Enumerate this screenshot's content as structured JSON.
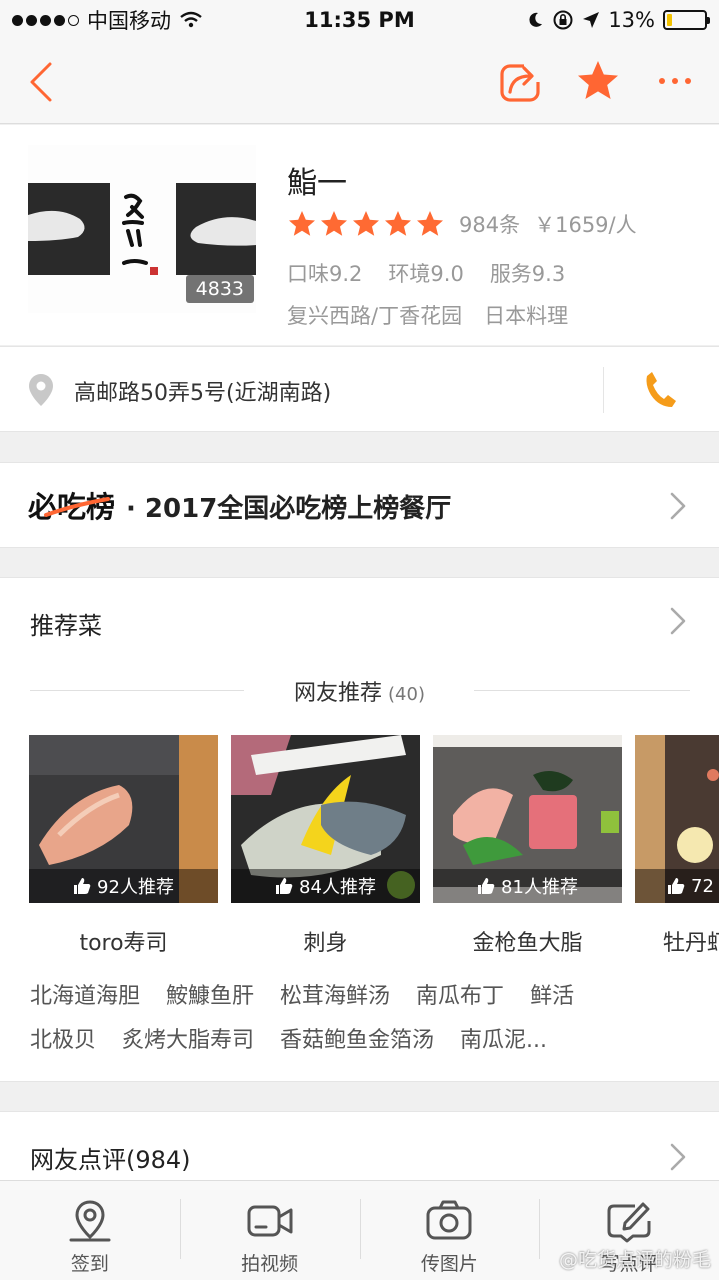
{
  "status_bar": {
    "carrier": "中国移动",
    "time": "11:35 PM",
    "battery": "13%",
    "battery_level": 0.13
  },
  "nav": {
    "back_icon": "chevron-left-icon",
    "share_icon": "share-icon",
    "favorite_icon": "star-icon",
    "more_icon": "more-icon"
  },
  "colors": {
    "accent": "#ff6633",
    "star": "#ff6a33",
    "phone": "#f59c1a"
  },
  "shop": {
    "name": "鮨一",
    "photo_count": "4833",
    "rating_stars": 5,
    "review_count": "984条",
    "price": "￥1659/人",
    "scores": [
      "口味9.2",
      "环境9.0",
      "服务9.3"
    ],
    "region": "复兴西路/丁香花园",
    "cuisine": "日本料理"
  },
  "address": {
    "text": "高邮路50弄5号(近湖南路)"
  },
  "must_eat": {
    "logo_text": "必吃榜",
    "text": "· 2017全国必吃榜上榜餐厅"
  },
  "dishes": {
    "title": "推荐菜",
    "subtitle": "网友推荐",
    "subtitle_count": "(40)",
    "items": [
      {
        "name": "toro寿司",
        "likes": "92人推荐"
      },
      {
        "name": "刺身",
        "likes": "84人推荐"
      },
      {
        "name": "金枪鱼大脂",
        "likes": "81人推荐"
      },
      {
        "name": "牡丹虾",
        "likes": "72"
      }
    ],
    "tags_row1": [
      "北海道海胆",
      "鮟鱇鱼肝",
      "松茸海鲜汤",
      "南瓜布丁",
      "鲜活"
    ],
    "tags_row2": [
      "北极贝",
      "炙烤大脂寿司",
      "香菇鲍鱼金箔汤",
      "南瓜泥..."
    ]
  },
  "reviews": {
    "title": "网友点评(984)"
  },
  "toolbar": {
    "checkin": "签到",
    "video": "拍视频",
    "photo": "传图片",
    "review": "写点评"
  },
  "watermark": "@吃货点评的粉毛"
}
